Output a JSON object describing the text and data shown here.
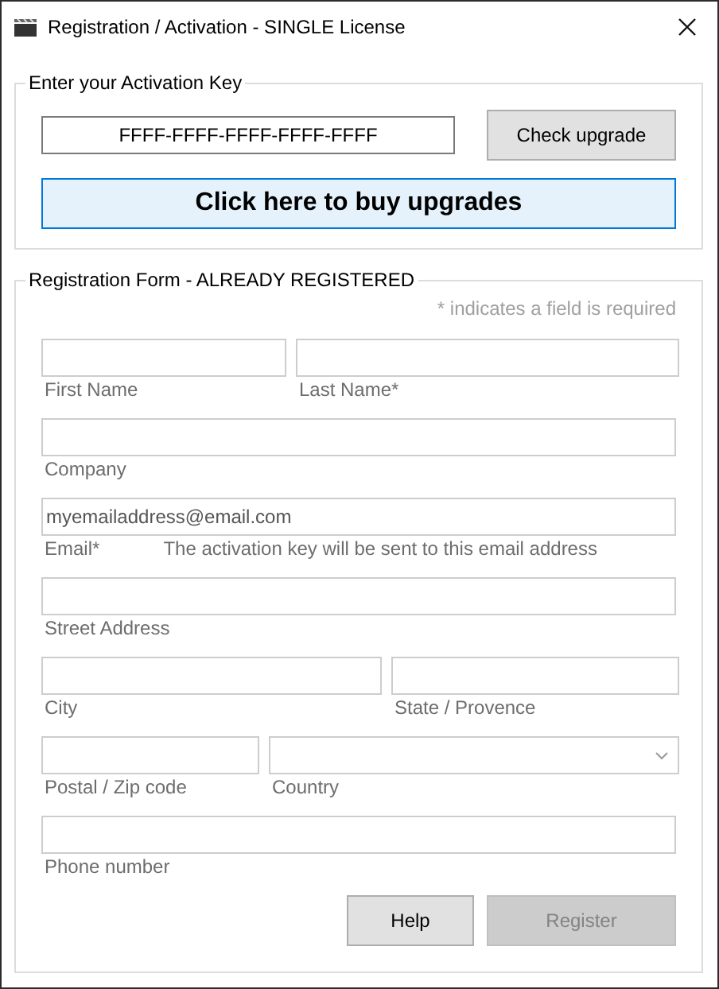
{
  "window": {
    "title": "Registration / Activation - SINGLE License"
  },
  "activation": {
    "legend": "Enter your Activation Key",
    "key": "FFFF-FFFF-FFFF-FFFF-FFFF",
    "check_button": "Check upgrade",
    "buy_button": "Click here to buy upgrades"
  },
  "form": {
    "legend": "Registration Form - ALREADY REGISTERED",
    "required_note": "* indicates a field is required",
    "rows": [
      [
        {
          "kind": "text",
          "label": "First Name"
        },
        {
          "kind": "text",
          "label": "Last Name*"
        }
      ],
      [
        {
          "kind": "text",
          "label": "Company"
        }
      ],
      [
        {
          "kind": "text",
          "label": "Email*",
          "value": "myemailaddress@email.com",
          "note": "The activation key will be sent to this email address"
        }
      ],
      [
        {
          "kind": "text",
          "label": "Street Address"
        }
      ],
      [
        {
          "kind": "text",
          "label": "City"
        },
        {
          "kind": "text",
          "label": "State / Provence"
        }
      ],
      [
        {
          "kind": "text",
          "label": "Postal / Zip code"
        },
        {
          "kind": "dropdown",
          "label": "Country"
        }
      ],
      [
        {
          "kind": "text",
          "label": "Phone number"
        }
      ]
    ]
  },
  "buttons": [
    {
      "label": "Help",
      "disabled": false
    },
    {
      "label": "Register",
      "disabled": true
    }
  ]
}
